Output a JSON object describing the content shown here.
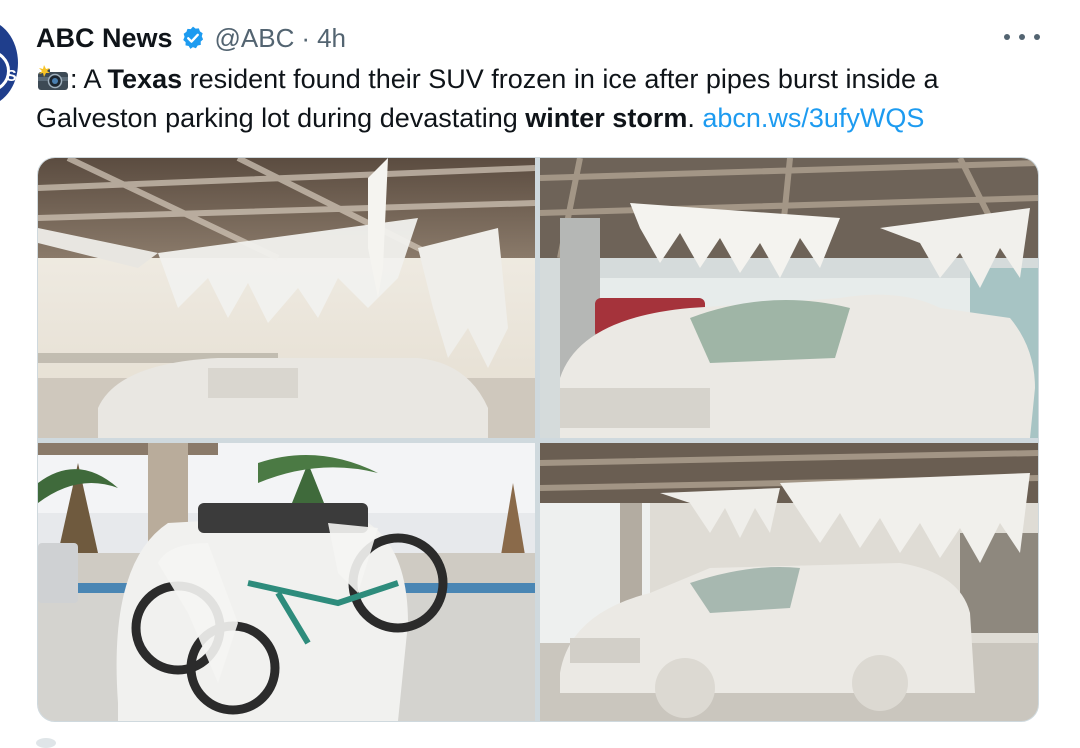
{
  "tweet": {
    "author_name": "ABC News",
    "verified": true,
    "handle": "@ABC",
    "separator": "·",
    "time": "4h",
    "camera_icon": "camera-with-flash-emoji",
    "text_parts": {
      "colon": ": A ",
      "bold_1": "Texas",
      "mid": " resident found their SUV frozen in ice after pipes burst inside a Galveston parking lot during devastating ",
      "bold_2": "winter storm",
      "period": ". ",
      "link": "abcn.ws/3ufyWQS"
    },
    "colors": {
      "link": "#1d9bf0",
      "verified": "#1d9bf0",
      "brand_avatar": "#1f3e8c"
    },
    "media": [
      {
        "icon": "photo-frozen-suv-parking-garage-icicles"
      },
      {
        "icon": "photo-ice-covered-suv-front-view"
      },
      {
        "icon": "photo-frozen-bicycle-rack-palm-trees"
      },
      {
        "icon": "photo-ice-encased-suv-side-view"
      }
    ]
  }
}
